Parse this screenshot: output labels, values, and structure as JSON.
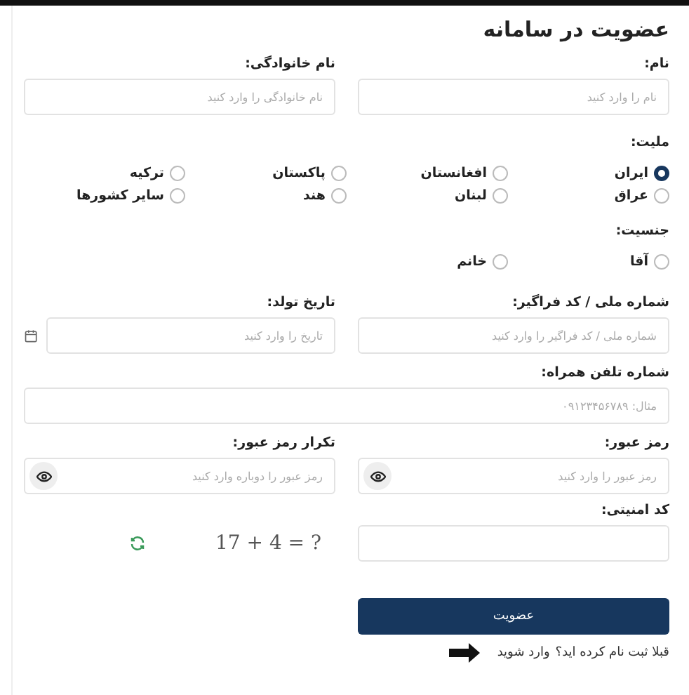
{
  "title": "عضویت در سامانه",
  "name_fields": [
    {
      "label": "نام:",
      "placeholder": "نام را وارد کنید"
    },
    {
      "label": "نام خانوادگی:",
      "placeholder": "نام خانوادگی را وارد کنید"
    }
  ],
  "nationality": {
    "label": "ملیت:",
    "options": [
      {
        "label": "ایران",
        "selected": true
      },
      {
        "label": "افغانستان",
        "selected": false
      },
      {
        "label": "پاکستان",
        "selected": false
      },
      {
        "label": "ترکیه",
        "selected": false
      },
      {
        "label": "عراق",
        "selected": false
      },
      {
        "label": "لبنان",
        "selected": false
      },
      {
        "label": "هند",
        "selected": false
      },
      {
        "label": "سایر کشورها",
        "selected": false
      }
    ]
  },
  "gender": {
    "label": "جنسیت:",
    "options": [
      {
        "label": "آقا",
        "selected": false
      },
      {
        "label": "خانم",
        "selected": false
      }
    ]
  },
  "id_fields": [
    {
      "label": "شماره ملی / کد فراگیر:",
      "placeholder": "شماره ملی / کد فراگیر را وارد کنید",
      "kind": "text"
    },
    {
      "label": "تاریخ تولد:",
      "placeholder": "تاریخ را وارد کنید",
      "kind": "date"
    }
  ],
  "phone": {
    "label": "شماره تلفن همراه:",
    "placeholder": "مثال: ۰۹۱۲۳۴۵۶۷۸۹"
  },
  "password_fields": [
    {
      "label": "رمز عبور:",
      "placeholder": "رمز عبور را وارد کنید"
    },
    {
      "label": "تکرار رمز عبور:",
      "placeholder": "رمز عبور را دوباره وارد کنید"
    }
  ],
  "security": {
    "label": "کد امنیتی:",
    "captcha": "17 + 4 = ?"
  },
  "submit": "عضویت",
  "login": {
    "question": "قبلا ثبت نام کرده اید؟",
    "link": "وارد شوید"
  }
}
